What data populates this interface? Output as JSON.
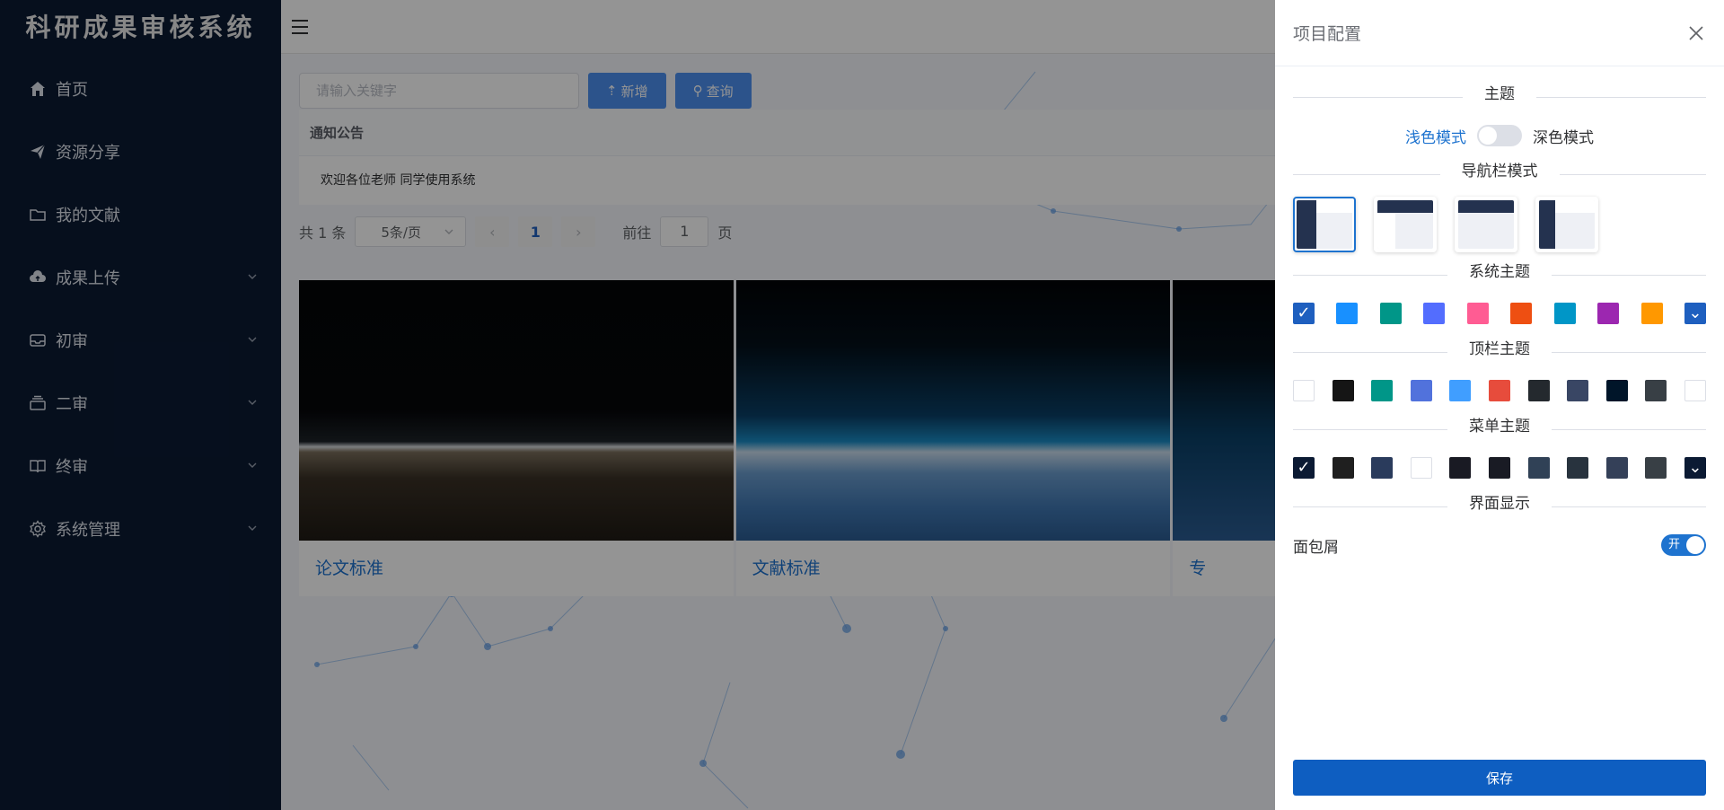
{
  "sidebar": {
    "title": "科研成果审核系统",
    "items": [
      {
        "label": "首页",
        "icon": "home-icon"
      },
      {
        "label": "资源分享",
        "icon": "send-icon"
      },
      {
        "label": "我的文献",
        "icon": "folder-icon"
      },
      {
        "label": "成果上传",
        "icon": "cloud-upload-icon"
      },
      {
        "label": "初审",
        "icon": "inbox-icon"
      },
      {
        "label": "二审",
        "icon": "stack-icon"
      },
      {
        "label": "终审",
        "icon": "book-icon"
      },
      {
        "label": "系统管理",
        "icon": "gear-icon"
      }
    ]
  },
  "toolbar": {
    "search_placeholder": "请输入关键字",
    "add_label": "新增",
    "query_label": "查询"
  },
  "notice": {
    "header": "通知公告",
    "row": "欢迎各位老师 同学使用系统"
  },
  "pager": {
    "total": "共 1 条",
    "page_size": "5条/页",
    "current_page": "1",
    "goto_label": "前往",
    "goto_value": "1",
    "page_suffix": "页"
  },
  "cards": [
    {
      "title": "论文标准"
    },
    {
      "title": "文献标准"
    },
    {
      "title": "专"
    }
  ],
  "drawer": {
    "title": "项目配置",
    "theme_section": "主题",
    "light_label": "浅色模式",
    "dark_label": "深色模式",
    "nav_section": "导航栏模式",
    "system_theme_section": "系统主题",
    "topbar_theme_section": "顶栏主题",
    "menu_theme_section": "菜单主题",
    "display_section": "界面显示",
    "breadcrumb_label": "面包屑",
    "breadcrumb_switch": "开",
    "save_label": "保存"
  },
  "colors": {
    "system": [
      "#1e5fbf",
      "#1890ff",
      "#009688",
      "#536dfe",
      "#ff5c93",
      "#ee4f12",
      "#0096c7",
      "#9c27b0",
      "#ff9800",
      "#1e5fbf"
    ],
    "topbar": [
      "#ffffff",
      "#151515",
      "#009688",
      "#5172dc",
      "#409eff",
      "#e74c3c",
      "#24292e",
      "#394664",
      "#001529",
      "#383f45",
      "#ffffff"
    ],
    "menu": [
      "#0b1a33",
      "#1f1f1f",
      "#2a3b5c",
      "#ffffff",
      "#191a23",
      "#191b24",
      "#304156",
      "#28333e",
      "#344058",
      "#383f45",
      "#0b1a33"
    ],
    "accent": "#1e73cf"
  }
}
